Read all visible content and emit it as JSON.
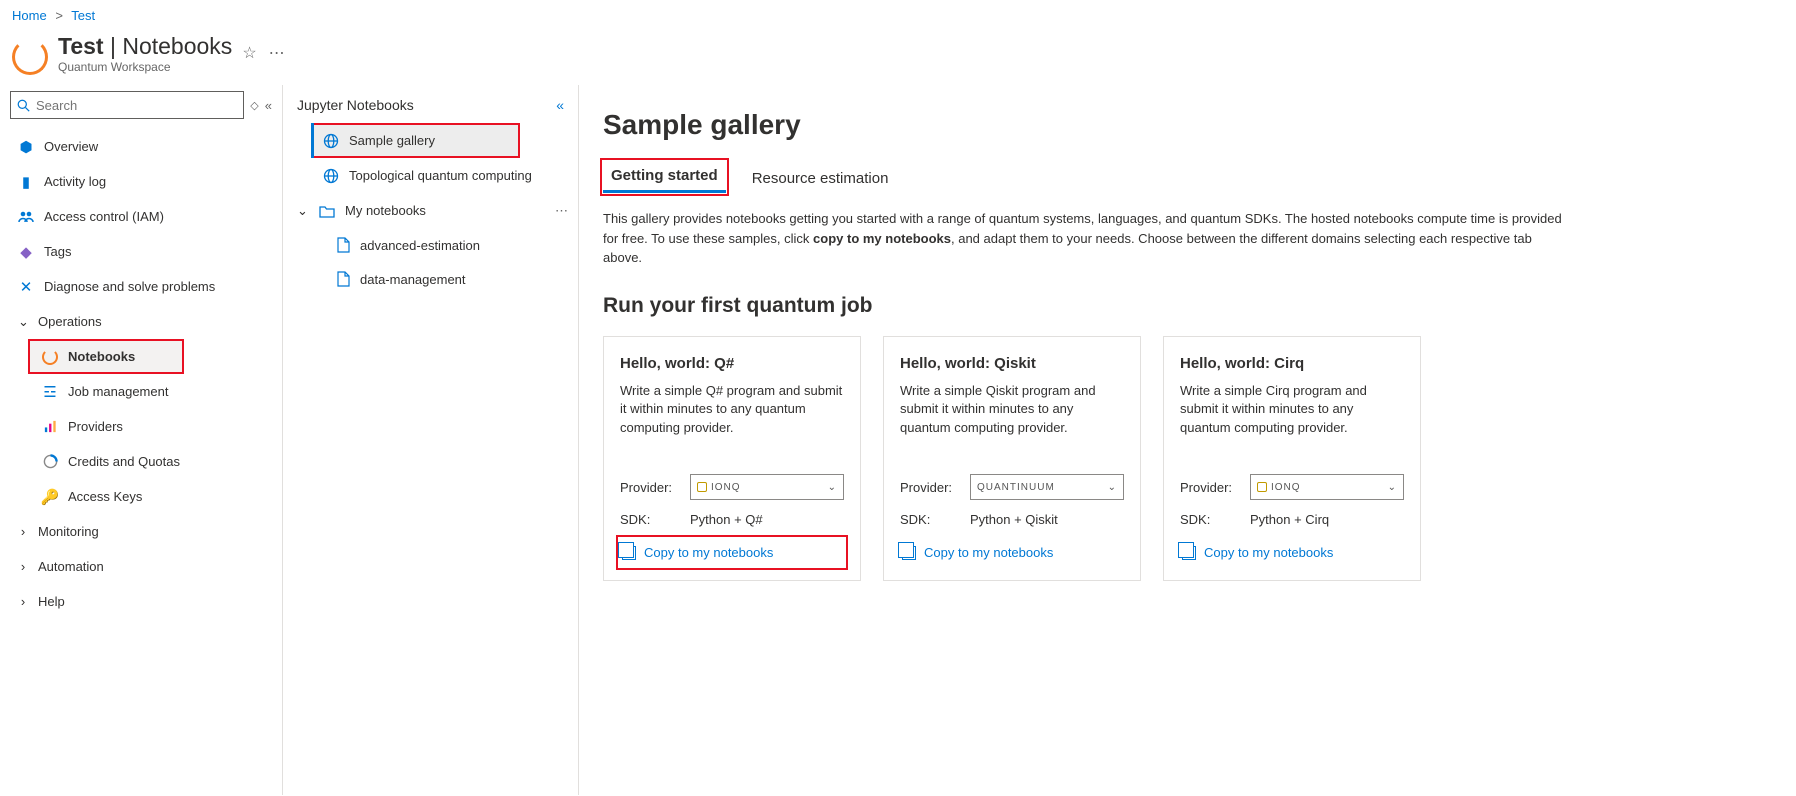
{
  "breadcrumb": {
    "home": "Home",
    "current": "Test"
  },
  "header": {
    "title_bold": "Test",
    "title_rest": " | Notebooks",
    "subtitle": "Quantum Workspace"
  },
  "search_placeholder": "Search",
  "nav": {
    "overview": "Overview",
    "activity": "Activity log",
    "iam": "Access control (IAM)",
    "tags": "Tags",
    "diagnose": "Diagnose and solve problems",
    "operations": "Operations",
    "notebooks": "Notebooks",
    "jobmgmt": "Job management",
    "providers": "Providers",
    "credits": "Credits and Quotas",
    "keys": "Access Keys",
    "monitoring": "Monitoring",
    "automation": "Automation",
    "help": "Help"
  },
  "tree": {
    "title": "Jupyter Notebooks",
    "sample": "Sample gallery",
    "topo": "Topological quantum computing",
    "mynb": "My notebooks",
    "file1": "advanced-estimation",
    "file2": "data-management"
  },
  "page": {
    "title": "Sample gallery",
    "tab_started": "Getting started",
    "tab_resource": "Resource estimation",
    "desc_1": "This gallery provides notebooks getting you started with a range of quantum systems, languages, and quantum SDKs. The hosted notebooks compute time is provided for free. To use these samples, click ",
    "desc_bold": "copy to my notebooks",
    "desc_2": ", and adapt them to your needs. Choose between the different domains selecting each respective tab above.",
    "section": "Run your first quantum job",
    "provider_label": "Provider:",
    "sdk_label": "SDK:",
    "copy_label": "Copy to my notebooks"
  },
  "cards": [
    {
      "title": "Hello, world: Q#",
      "desc": "Write a simple Q# program and submit it within minutes to any quantum computing provider.",
      "provider": "IONQ",
      "sdk": "Python + Q#"
    },
    {
      "title": "Hello, world: Qiskit",
      "desc": "Write a simple Qiskit program and submit it within minutes to any quantum computing provider.",
      "provider": "QUANTINUUM",
      "sdk": "Python + Qiskit"
    },
    {
      "title": "Hello, world: Cirq",
      "desc": "Write a simple Cirq program and submit it within minutes to any quantum computing provider.",
      "provider": "IONQ",
      "sdk": "Python + Cirq"
    }
  ]
}
